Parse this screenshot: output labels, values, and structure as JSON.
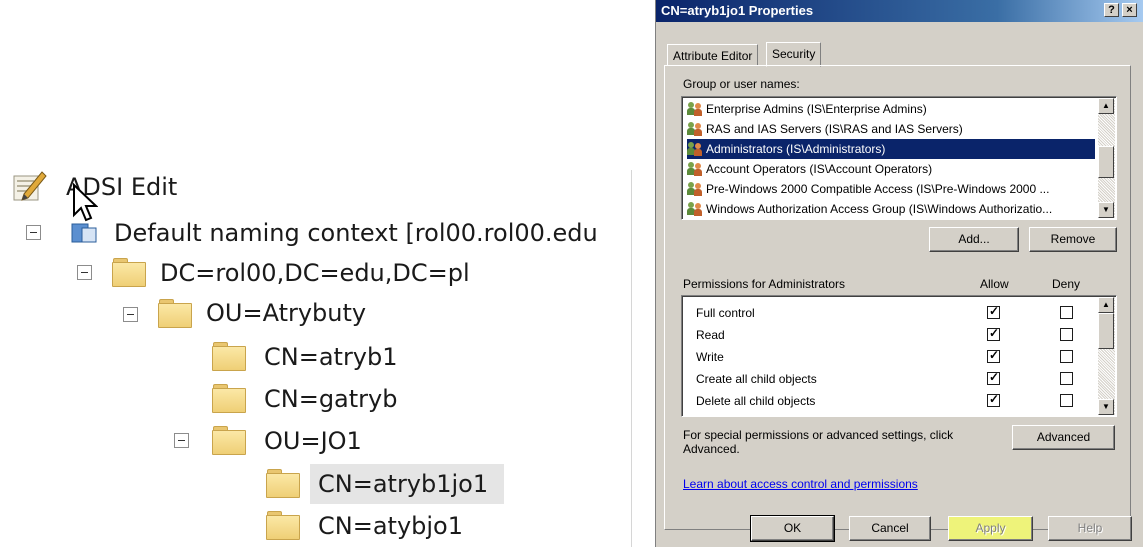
{
  "tree": {
    "root_label": "ADSI Edit",
    "naming_context": "Default naming context [rol00.rol00.edu",
    "domain": "DC=rol00,DC=edu,DC=pl",
    "ou_atrybuty": "OU=Atrybuty",
    "cn_atryb1": "CN=atryb1",
    "cn_gatryb": "CN=gatryb",
    "ou_jo1": "OU=JO1",
    "cn_atryb1jo1": "CN=atryb1jo1",
    "cn_atybjo1": "CN=atybjo1"
  },
  "dialog": {
    "title": "CN=atryb1jo1 Properties",
    "help_glyph": "?",
    "close_glyph": "×",
    "tabs": [
      "Attribute Editor",
      "Security"
    ],
    "active_tab": "Security",
    "group_label": "Group or user names:",
    "users": [
      "Enterprise Admins (IS\\Enterprise Admins)",
      "RAS and IAS Servers (IS\\RAS and IAS Servers)",
      "Administrators (IS\\Administrators)",
      "Account Operators (IS\\Account Operators)",
      "Pre-Windows 2000 Compatible Access (IS\\Pre-Windows 2000 ...",
      "Windows Authorization Access Group (IS\\Windows Authorizatio..."
    ],
    "selected_user": "Administrators (IS\\Administrators)",
    "add_label": "Add...",
    "remove_label": "Remove",
    "permissions_label": "Permissions for Administrators",
    "allow_header": "Allow",
    "deny_header": "Deny",
    "permissions": [
      {
        "name": "Full control",
        "allow": true,
        "deny": false
      },
      {
        "name": "Read",
        "allow": true,
        "deny": false
      },
      {
        "name": "Write",
        "allow": true,
        "deny": false
      },
      {
        "name": "Create all child objects",
        "allow": true,
        "deny": false
      },
      {
        "name": "Delete all child objects",
        "allow": true,
        "deny": false
      }
    ],
    "special_text_1": "For special permissions or advanced settings, click",
    "special_text_2": "Advanced.",
    "advanced_label": "Advanced",
    "learn_link": "Learn about access control and permissions",
    "ok_label": "OK",
    "cancel_label": "Cancel",
    "apply_label": "Apply",
    "help_label": "Help",
    "colors": {
      "title_start": "#0a246a",
      "selection": "#0a246a",
      "face": "#d4d0c8",
      "apply_highlight": "#eef37a"
    }
  }
}
